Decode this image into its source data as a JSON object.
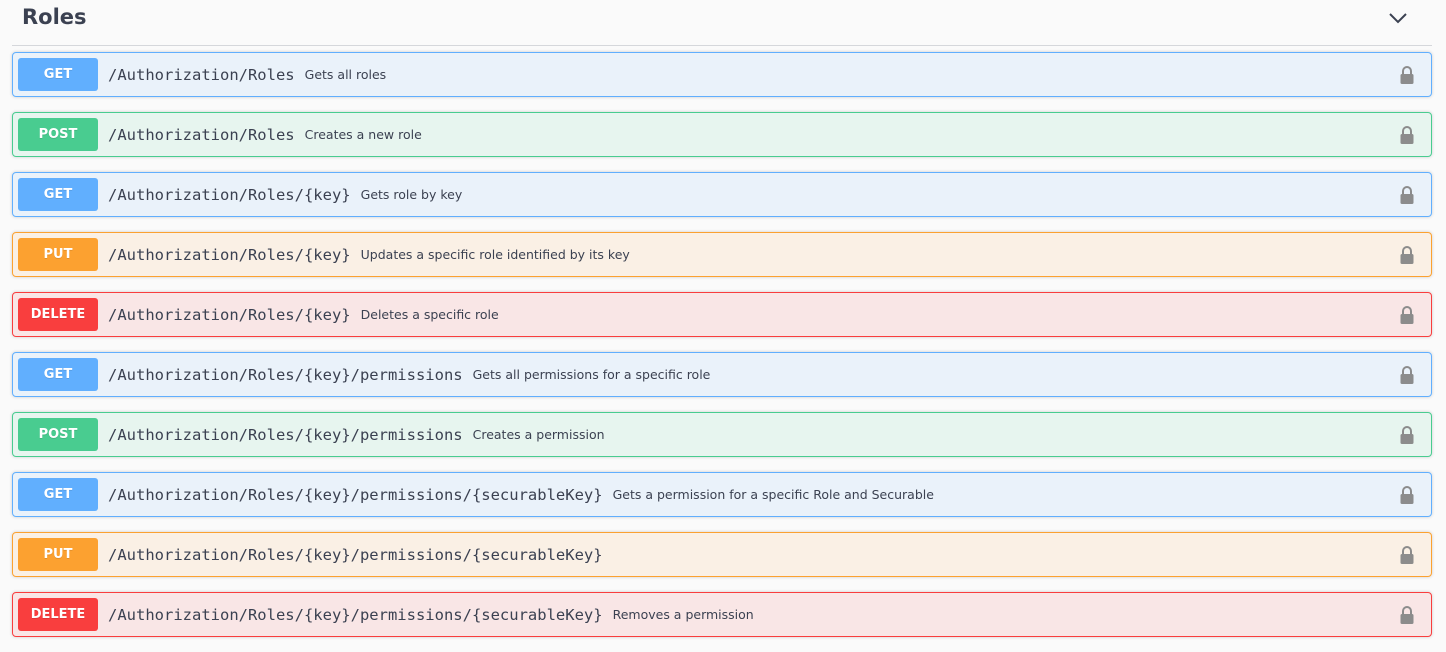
{
  "section": {
    "title": "Roles",
    "toggle_icon": "chevron-down-icon"
  },
  "colors": {
    "get": "#61affe",
    "post": "#49cc90",
    "put": "#fca130",
    "delete": "#f93e3e"
  },
  "operations": [
    {
      "method": "GET",
      "path": "/Authorization/Roles",
      "summary": "Gets all roles"
    },
    {
      "method": "POST",
      "path": "/Authorization/Roles",
      "summary": "Creates a new role"
    },
    {
      "method": "GET",
      "path": "/Authorization/Roles/{key}",
      "summary": "Gets role by key"
    },
    {
      "method": "PUT",
      "path": "/Authorization/Roles/{key}",
      "summary": "Updates a specific role identified by its key"
    },
    {
      "method": "DELETE",
      "path": "/Authorization/Roles/{key}",
      "summary": "Deletes a specific role"
    },
    {
      "method": "GET",
      "path": "/Authorization/Roles/{key}/permissions",
      "summary": "Gets all permissions for a specific role"
    },
    {
      "method": "POST",
      "path": "/Authorization/Roles/{key}/permissions",
      "summary": "Creates a permission"
    },
    {
      "method": "GET",
      "path": "/Authorization/Roles/{key}/permissions/{securableKey}",
      "summary": "Gets a permission for a specific Role and Securable"
    },
    {
      "method": "PUT",
      "path": "/Authorization/Roles/{key}/permissions/{securableKey}",
      "summary": ""
    },
    {
      "method": "DELETE",
      "path": "/Authorization/Roles/{key}/permissions/{securableKey}",
      "summary": "Removes a permission"
    }
  ],
  "lock_icon": "lock-icon"
}
